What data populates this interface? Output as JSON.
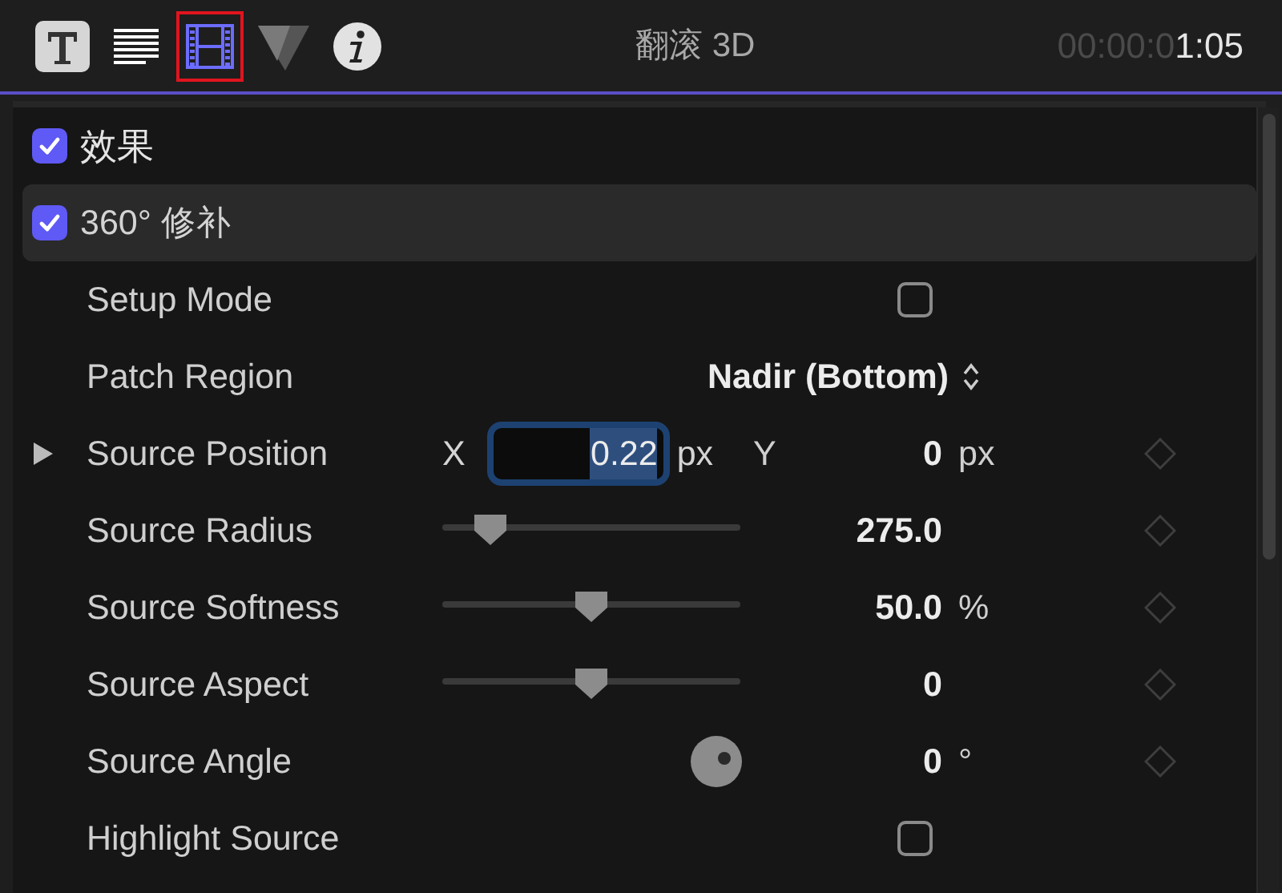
{
  "toolbar": {
    "tabs": [
      {
        "kind": "text",
        "selected": false
      },
      {
        "kind": "lines",
        "selected": false
      },
      {
        "kind": "film",
        "selected": true
      },
      {
        "kind": "triangle",
        "selected": false
      },
      {
        "kind": "info",
        "selected": false
      }
    ],
    "title": "翻滚 3D",
    "timecode_lead": "00:00:0",
    "timecode": "1:05"
  },
  "section": {
    "title": "效果",
    "checked": true
  },
  "effect": {
    "title": "360° 修补",
    "checked": true
  },
  "params": [
    {
      "kind": "checkbox",
      "label": "Setup Mode",
      "checked": false
    },
    {
      "kind": "popup",
      "label": "Patch Region",
      "value": "Nadir (Bottom)"
    },
    {
      "kind": "point",
      "label": "Source Position",
      "expanded": false,
      "x_label": "X",
      "x_value": "0.22",
      "x_focused": true,
      "x_unit": "px",
      "y_label": "Y",
      "y_value": "0",
      "y_unit": "px",
      "keyframe": true
    },
    {
      "kind": "slider",
      "label": "Source Radius",
      "level": 0.16,
      "value": "275.0",
      "keyframe": true
    },
    {
      "kind": "slider",
      "label": "Source Softness",
      "level": 0.5,
      "value": "50.0",
      "unit": "%",
      "keyframe": true
    },
    {
      "kind": "slider",
      "label": "Source Aspect",
      "level": 0.5,
      "value": "0",
      "keyframe": true
    },
    {
      "kind": "angle",
      "label": "Source Angle",
      "value": "0",
      "unit": "°",
      "keyframe": true
    },
    {
      "kind": "checkbox",
      "label": "Highlight Source",
      "checked": false
    }
  ]
}
